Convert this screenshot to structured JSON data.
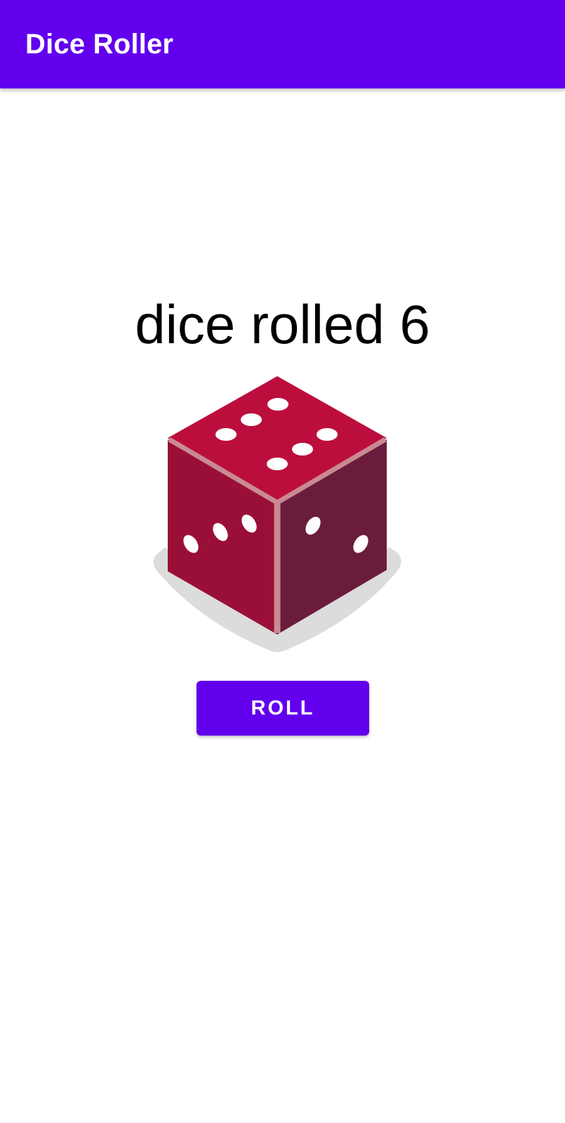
{
  "app_bar": {
    "title": "Dice Roller",
    "color": "#6200ee"
  },
  "main": {
    "result_text": "dice rolled 6",
    "dice": {
      "icon": "dice-six-icon",
      "value": 6,
      "colors": {
        "top": "#bc0e3c",
        "left": "#9a0f38",
        "right": "#6b1c3c",
        "edge": "#c98a92",
        "shadow": "#dcdcdc",
        "pip": "#ffffff"
      }
    },
    "roll_button": {
      "label": "ROLL",
      "color": "#6200ee"
    }
  }
}
